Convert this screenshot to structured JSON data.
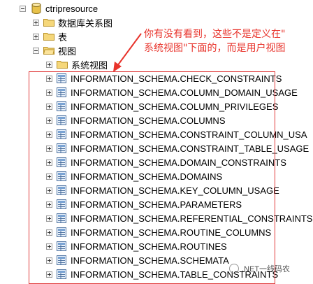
{
  "tree": {
    "database": {
      "label": "ctripresource"
    },
    "level1": [
      {
        "label": "数据库关系图",
        "state": "collapsed"
      },
      {
        "label": "表",
        "state": "collapsed"
      },
      {
        "label": "视图",
        "state": "expanded"
      }
    ],
    "system_views": {
      "label": "系统视图"
    },
    "views": [
      "INFORMATION_SCHEMA.CHECK_CONSTRAINTS",
      "INFORMATION_SCHEMA.COLUMN_DOMAIN_USAGE",
      "INFORMATION_SCHEMA.COLUMN_PRIVILEGES",
      "INFORMATION_SCHEMA.COLUMNS",
      "INFORMATION_SCHEMA.CONSTRAINT_COLUMN_USA",
      "INFORMATION_SCHEMA.CONSTRAINT_TABLE_USAGE",
      "INFORMATION_SCHEMA.DOMAIN_CONSTRAINTS",
      "INFORMATION_SCHEMA.DOMAINS",
      "INFORMATION_SCHEMA.KEY_COLUMN_USAGE",
      "INFORMATION_SCHEMA.PARAMETERS",
      "INFORMATION_SCHEMA.REFERENTIAL_CONSTRAINTS",
      "INFORMATION_SCHEMA.ROUTINE_COLUMNS",
      "INFORMATION_SCHEMA.ROUTINES",
      "INFORMATION_SCHEMA.SCHEMATA",
      "INFORMATION_SCHEMA.TABLE_CONSTRAINTS"
    ]
  },
  "annotation": {
    "line1": "你有没有看到，这些不是定义在\"",
    "line2": "系统视图\"下面的，而是用户视图",
    "color": "#e8332b"
  },
  "watermark": {
    "text": ".NET一线码农"
  }
}
